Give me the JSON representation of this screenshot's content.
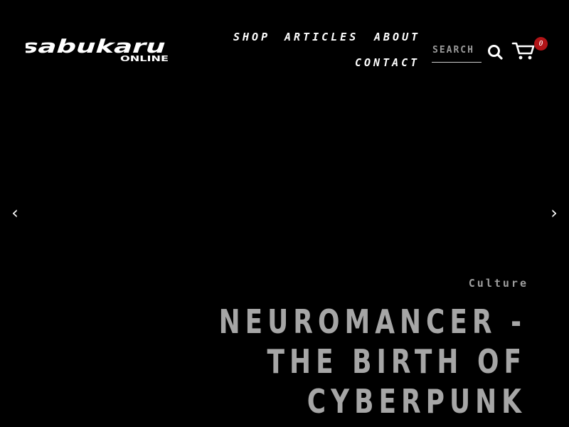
{
  "brand": {
    "logo_text": "sabukaru",
    "logo_subtext": "ONLINE"
  },
  "nav": {
    "items": [
      {
        "label": "SHOP"
      },
      {
        "label": "ARTICLES"
      },
      {
        "label": "ABOUT"
      },
      {
        "label": "CONTACT"
      }
    ]
  },
  "search": {
    "placeholder": "SEARCH",
    "value": "",
    "icon": "search-icon"
  },
  "cart": {
    "icon": "cart-icon",
    "count": "0"
  },
  "slider": {
    "prev_label": "‹",
    "next_label": "›",
    "slide": {
      "category": "Culture",
      "title": "NEUROMANCER - THE BIRTH OF CYBERPUNK"
    }
  },
  "colors": {
    "background": "#000000",
    "text": "#ffffff",
    "muted_text": "#a6a6a6",
    "badge": "#b11417"
  }
}
